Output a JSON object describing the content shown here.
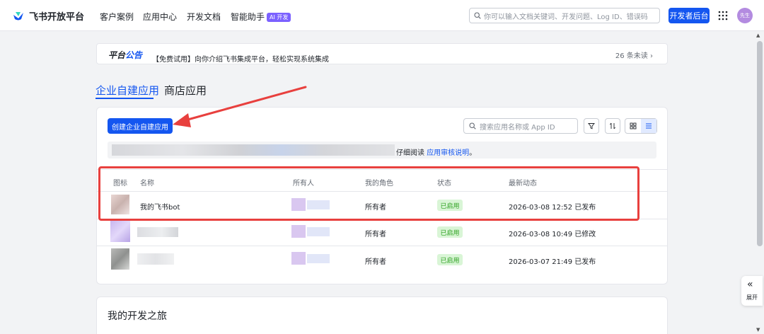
{
  "header": {
    "brand": "飞书开放平台",
    "nav": [
      {
        "label": "客户案例"
      },
      {
        "label": "应用中心"
      },
      {
        "label": "开发文档"
      },
      {
        "label": "智能助手",
        "badge": "AI 开发"
      }
    ],
    "search_placeholder": "你可以输入文档关键词、开发问题、Log ID、错误码",
    "dev_console_label": "开发者后台",
    "avatar_text": "先生"
  },
  "announcement": {
    "title_prefix": "平台",
    "title_highlight": "公告",
    "text": "【免费试用】向你介绍飞书集成平台，轻松实现系统集成",
    "unread": "26 条未读 ›"
  },
  "tabs": [
    {
      "label": "企业自建应用",
      "active": true
    },
    {
      "label": "商店应用",
      "active": false
    }
  ],
  "toolbar": {
    "create_label": "创建企业自建应用",
    "search_placeholder": "搜索应用名称或 App ID"
  },
  "notice": {
    "text": "仔细阅读 ",
    "link": "应用审核说明",
    "suffix": "。"
  },
  "table": {
    "columns": [
      "图标",
      "名称",
      "所有人",
      "我的角色",
      "状态",
      "最新动态"
    ],
    "rows": [
      {
        "name": "我的飞书bot",
        "role": "所有者",
        "status": "已启用",
        "latest": "2026-03-08 12:52 已发布"
      },
      {
        "name": "",
        "role": "所有者",
        "status": "已启用",
        "latest": "2026-03-08 10:49 已修改"
      },
      {
        "name": "",
        "role": "所有者",
        "status": "已启用",
        "latest": "2026-03-07 21:49 已发布"
      }
    ]
  },
  "journey": {
    "title": "我的开发之旅"
  },
  "side": {
    "expand_label": "展开"
  },
  "colors": {
    "primary": "#1456f0",
    "annotation_red": "#e8403e",
    "status_green": "#2ea121"
  }
}
